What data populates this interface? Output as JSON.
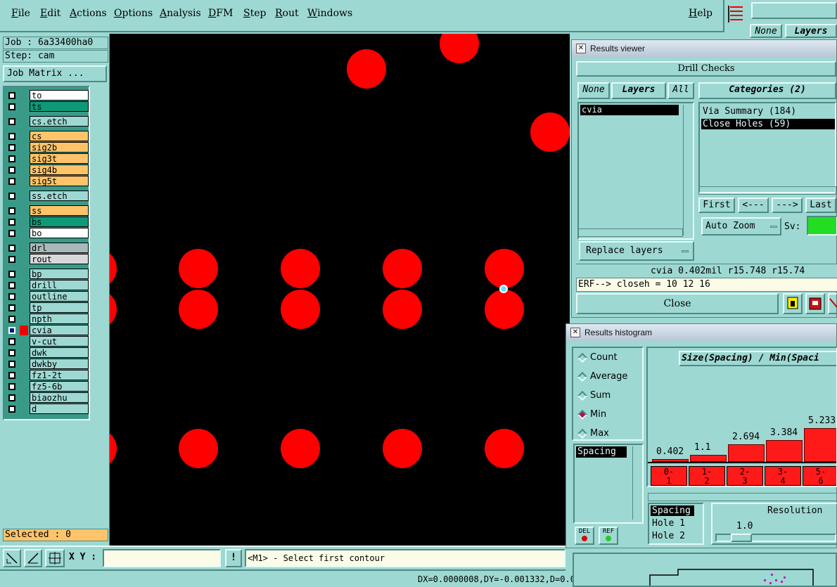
{
  "menubar": {
    "items": [
      "File",
      "Edit",
      "Actions",
      "Options",
      "Analysis",
      "DFM",
      "Step",
      "Rout",
      "Windows"
    ],
    "help": "Help"
  },
  "left": {
    "job": "Job : 6a33400ha0",
    "step": "Step: cam",
    "job_matrix": "Job Matrix ...",
    "selected": "Selected : 0"
  },
  "layers": [
    {
      "name": "to",
      "color": "#ffffff"
    },
    {
      "name": "ts",
      "color": "#0e9a78"
    },
    {
      "name": "cs.etch",
      "color": "#9ed8d2"
    },
    {
      "name": "cs",
      "color": "#ffc46a"
    },
    {
      "name": "sig2b",
      "color": "#ffc46a"
    },
    {
      "name": "sig3t",
      "color": "#ffc46a"
    },
    {
      "name": "sig4b",
      "color": "#ffc46a"
    },
    {
      "name": "sig5t",
      "color": "#ffc46a"
    },
    {
      "name": "ss.etch",
      "color": "#9ed8d2"
    },
    {
      "name": "ss",
      "color": "#ffc46a"
    },
    {
      "name": "bs",
      "color": "#0e9a78"
    },
    {
      "name": "bo",
      "color": "#ffffff"
    },
    {
      "name": "drl",
      "color": "#a9b8b8"
    },
    {
      "name": "rout",
      "color": "#d8d8d8"
    },
    {
      "name": "bp",
      "color": "#9ed8d2"
    },
    {
      "name": "drill",
      "color": "#9ed8d2"
    },
    {
      "name": "outline",
      "color": "#9ed8d2"
    },
    {
      "name": "tp",
      "color": "#9ed8d2"
    },
    {
      "name": "npth",
      "color": "#9ed8d2"
    },
    {
      "name": "cvia",
      "color": "#9ed8d2"
    },
    {
      "name": "v-cut",
      "color": "#9ed8d2"
    },
    {
      "name": "dwk",
      "color": "#9ed8d2"
    },
    {
      "name": "dwkby",
      "color": "#9ed8d2"
    },
    {
      "name": "fz1-2t",
      "color": "#9ed8d2"
    },
    {
      "name": "fz5-6b",
      "color": "#9ed8d2"
    },
    {
      "name": "biaozhu",
      "color": "#9ed8d2"
    },
    {
      "name": "d",
      "color": "#9ed8d2"
    }
  ],
  "bottom": {
    "xy_label": "X Y :",
    "xy_value": "",
    "prompt": "<M1> - Select first contour",
    "status": "DX=0.0000008,DY=-0.001332,D=0.0"
  },
  "results_viewer": {
    "title": "Results viewer",
    "header": "Drill Checks",
    "none": "None",
    "layers": "Layers",
    "all": "All",
    "categories_label": "Categories (2)",
    "layer_items": [
      "cvia"
    ],
    "category_items": [
      "Via Summary (184)",
      "Close Holes (59)"
    ],
    "first": "First",
    "prev": "<---",
    "next": "--->",
    "last": "Last",
    "auto_zoom": "Auto Zoom",
    "sv": "Sv:",
    "replace_layers": "Replace layers",
    "info_line": "cvia 0.402mil  r15.748  r15.74",
    "erf_line": "ERF--> closeh = 10 12 16",
    "close": "Close",
    "sv_color": "#22dd22"
  },
  "histogram": {
    "title": "Results histogram",
    "modes": [
      {
        "label": "Count",
        "on": false
      },
      {
        "label": "Average",
        "on": false
      },
      {
        "label": "Sum",
        "on": false
      },
      {
        "label": "Min",
        "on": true
      },
      {
        "label": "Max",
        "on": false
      }
    ],
    "list_item": "Spacing",
    "y_title": "Size(Spacing) / Min(Spaci",
    "bars": [
      0.402,
      1.1,
      2.694,
      3.384,
      5.233
    ],
    "bins": [
      "0-\n1",
      "1-\n2",
      "2-\n3",
      "3-\n4",
      "5-\n6"
    ],
    "sub_items": [
      "Spacing",
      "Hole 1",
      "Hole 2"
    ],
    "resolution_label": "Resolution",
    "resolution_value": "1.0",
    "del": "DEL",
    "ref": "REF",
    "bar_labels": [
      "0.402",
      "1.1",
      "2.694",
      "3.384",
      "5.233"
    ]
  },
  "topright": {
    "none": "None",
    "layers": "Layers"
  }
}
